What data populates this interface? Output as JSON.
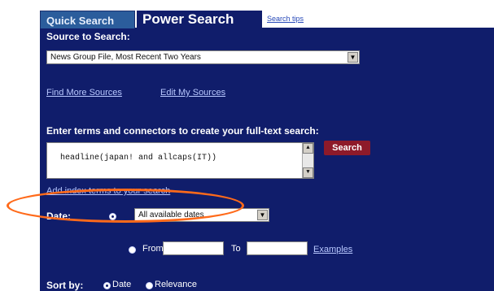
{
  "tabs": {
    "quick_search": "Quick Search",
    "power_search": "Power Search",
    "search_tips": "Search tips"
  },
  "source": {
    "label": "Source to Search:",
    "selected": "News Group File, Most Recent Two Years",
    "find_more": "Find More Sources",
    "edit_sources": "Edit My Sources"
  },
  "query": {
    "label": "Enter terms and connectors to create your full-text search:",
    "value": "headline(japan! and allcaps(IT))",
    "search_button": "Search",
    "add_index_terms": "Add index terms to your search"
  },
  "date": {
    "label": "Date:",
    "selected": "All available dates",
    "from_label": "From",
    "to_label": "To",
    "from_value": "",
    "to_value": "",
    "examples": "Examples"
  },
  "sort": {
    "label": "Sort by:",
    "option_date": "Date",
    "option_relevance": "Relevance"
  },
  "colors": {
    "panel": "#101d6b",
    "search_button": "#8e1a2a",
    "highlight_oval": "#ff6a1a"
  }
}
